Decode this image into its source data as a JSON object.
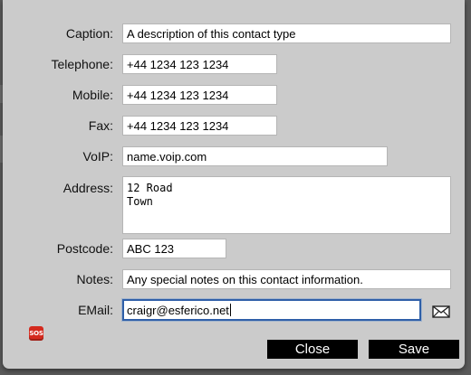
{
  "form": {
    "caption": {
      "label": "Caption:",
      "value": "A description of this contact type"
    },
    "telephone": {
      "label": "Telephone:",
      "value": "+44 1234 123 1234"
    },
    "mobile": {
      "label": "Mobile:",
      "value": "+44 1234 123 1234"
    },
    "fax": {
      "label": "Fax:",
      "value": "+44 1234 123 1234"
    },
    "voip": {
      "label": "VoIP:",
      "value": "name.voip.com"
    },
    "address": {
      "label": "Address:",
      "value": "12 Road\nTown"
    },
    "postcode": {
      "label": "Postcode:",
      "value": "ABC 123"
    },
    "notes": {
      "label": "Notes:",
      "value": "Any special notes on this contact information."
    },
    "email": {
      "label": "EMail:",
      "value": "craigr@esferico.net"
    }
  },
  "icons": {
    "mail": "envelope-icon",
    "sos": {
      "name": "sos-icon",
      "text": "SOS",
      "color": "#d42a1e"
    }
  },
  "buttons": {
    "close": "Close",
    "save": "Save"
  },
  "colors": {
    "dialog_bg": "#cbcbcb",
    "button_bg": "#000000",
    "focus_ring": "#2f5fa8"
  }
}
